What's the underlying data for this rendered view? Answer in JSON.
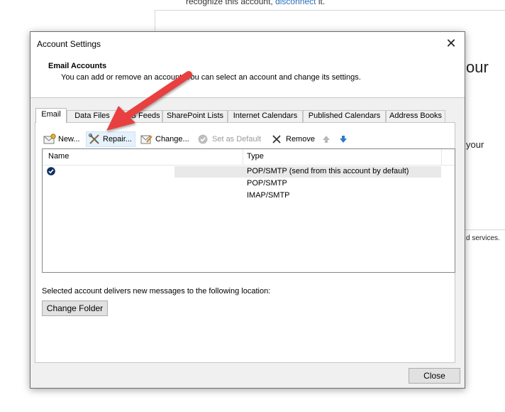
{
  "background": {
    "top_text_prefix": "recognize this account,",
    "top_text_link": "disconnect",
    "top_text_suffix": "it.",
    "big_text": "our",
    "side_text": "your",
    "services_text": "d services."
  },
  "dialog": {
    "title": "Account Settings",
    "header_title": "Email Accounts",
    "header_desc": "You can add or remove an account. You can select an account and change its settings.",
    "tabs": [
      {
        "label": "Email"
      },
      {
        "label": "Data Files"
      },
      {
        "label": "RSS Feeds"
      },
      {
        "label": "SharePoint Lists"
      },
      {
        "label": "Internet Calendars"
      },
      {
        "label": "Published Calendars"
      },
      {
        "label": "Address Books"
      }
    ],
    "toolbar": {
      "new": "New...",
      "repair": "Repair...",
      "change": "Change...",
      "set_default": "Set as Default",
      "remove": "Remove"
    },
    "list": {
      "col_name": "Name",
      "col_type": "Type",
      "rows": [
        {
          "type": "POP/SMTP (send from this account by default)"
        },
        {
          "type": "POP/SMTP"
        },
        {
          "type": "IMAP/SMTP"
        }
      ]
    },
    "deliver_text": "Selected account delivers new messages to the following location:",
    "change_folder": "Change Folder",
    "close": "Close"
  },
  "colors": {
    "annotation_arrow": "#e8403f",
    "link": "#2a6ebb",
    "move_down_arrow": "#2e78d6"
  }
}
